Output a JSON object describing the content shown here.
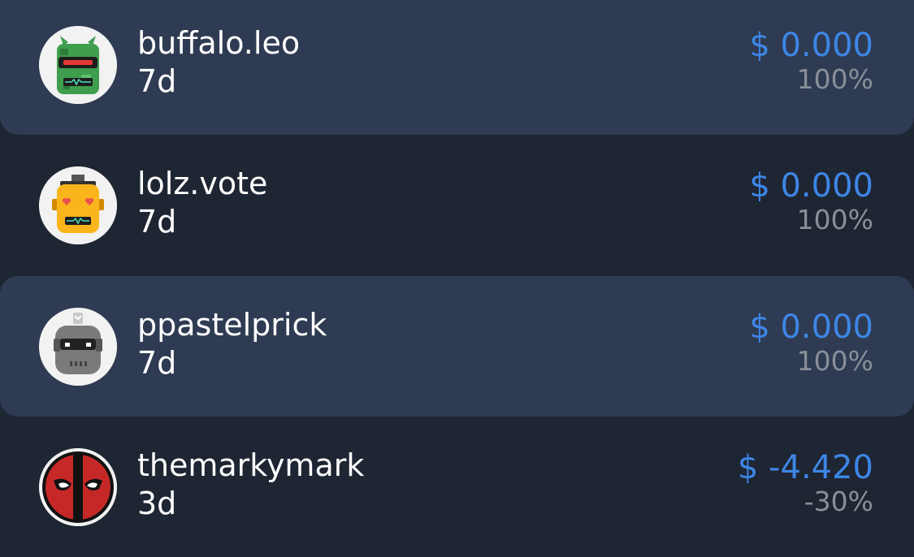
{
  "rows": [
    {
      "name": "buffalo.leo",
      "age": "7d",
      "value": "$ 0.000",
      "percent": "100%",
      "avatar_icon": "green-robot-avatar-icon",
      "highlighted": true
    },
    {
      "name": "lolz.vote",
      "age": "7d",
      "value": "$ 0.000",
      "percent": "100%",
      "avatar_icon": "yellow-heart-eyes-robot-avatar-icon",
      "highlighted": false
    },
    {
      "name": "ppastelprick",
      "age": "7d",
      "value": "$ 0.000",
      "percent": "100%",
      "avatar_icon": "grey-robot-avatar-icon",
      "highlighted": true
    },
    {
      "name": "themarkymark",
      "age": "3d",
      "value": "$ -4.420",
      "percent": "-30%",
      "avatar_icon": "deadpool-mask-avatar-icon",
      "highlighted": false
    }
  ],
  "colors": {
    "background": "#1e2533",
    "highlight": "#2e3b52",
    "value": "#3d86e6",
    "percent": "#8a8f98",
    "text": "#ffffff"
  }
}
